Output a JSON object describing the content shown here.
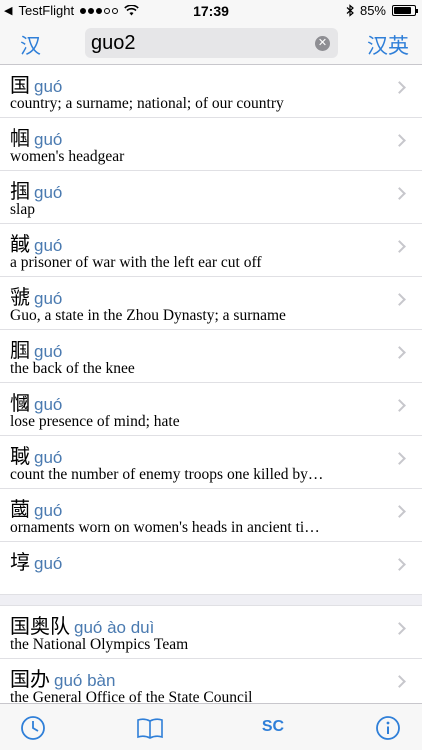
{
  "status_bar": {
    "carrier": "TestFlight",
    "time": "17:39",
    "battery": "85%",
    "battery_level": 0.85,
    "signal_bars": 3
  },
  "nav": {
    "left_button": "汉",
    "right_button": "汉英",
    "search_value": "guo2"
  },
  "results": [
    {
      "chars": "国",
      "pinyin": "guó",
      "gloss": "country; a surname; national; of our country"
    },
    {
      "chars": "帼",
      "pinyin": "guó",
      "gloss": "women's headgear"
    },
    {
      "chars": "掴",
      "pinyin": "guó",
      "gloss": "slap"
    },
    {
      "chars": "馘",
      "pinyin": "guó",
      "gloss": "a prisoner of war with the left ear cut off"
    },
    {
      "chars": "虢",
      "pinyin": "guó",
      "gloss": "Guo, a state in the Zhou Dynasty; a surname"
    },
    {
      "chars": "腘",
      "pinyin": "guó",
      "gloss": "the back of the knee"
    },
    {
      "chars": "慖",
      "pinyin": "guó",
      "gloss": "lose presence of mind; hate"
    },
    {
      "chars": "聝",
      "pinyin": "guó",
      "gloss": "count the number of enemy troops one killed by…"
    },
    {
      "chars": "蔮",
      "pinyin": "guó",
      "gloss": "ornaments worn on women's heads in ancient ti…"
    },
    {
      "chars": "埻",
      "pinyin": "guó",
      "gloss": ""
    }
  ],
  "compounds": [
    {
      "chars": "国奥队",
      "pinyin": "guó ào duì",
      "gloss": "the National Olympics Team"
    },
    {
      "chars": "国办",
      "pinyin": "guó bàn",
      "gloss": "the General Office of the State Council"
    }
  ],
  "tab_bar": {
    "sc_label": "SC",
    "icons": [
      "history-icon",
      "book-icon",
      "info-icon"
    ]
  },
  "colors": {
    "accent": "#2f7fd8",
    "pinyin": "#4a7ab0"
  }
}
